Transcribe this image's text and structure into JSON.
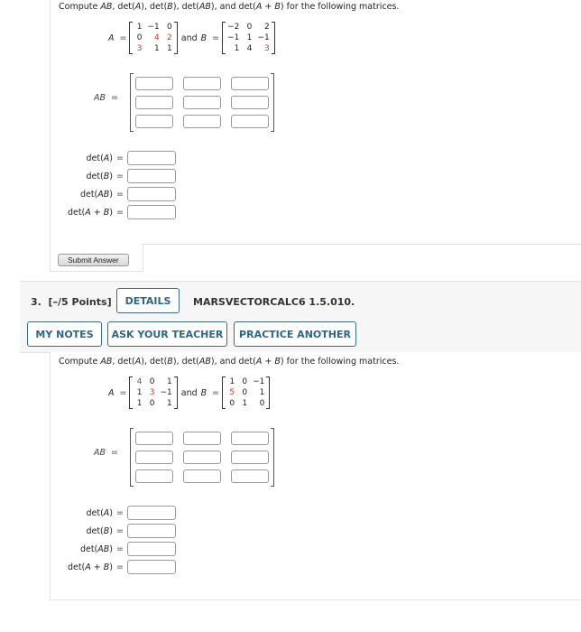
{
  "question2": {
    "prompt": {
      "pre": "Compute ",
      "parts": [
        "AB",
        ", det(",
        "A",
        "), det(",
        "B",
        "), det(",
        "AB",
        "), and det(",
        "A + B",
        ") for the following matrices."
      ]
    },
    "matrix_a_label": "A",
    "matrix_b_label": "B",
    "equals": "=",
    "and_text": "and",
    "matrix_a": [
      [
        "1",
        "−1",
        "0"
      ],
      [
        "0",
        "4",
        "2"
      ],
      [
        "3",
        "1",
        "1"
      ]
    ],
    "matrix_a_red": [
      [
        false,
        false,
        false
      ],
      [
        false,
        true,
        true
      ],
      [
        true,
        false,
        false
      ]
    ],
    "matrix_b": [
      [
        "−2",
        "0",
        "2"
      ],
      [
        "−1",
        "1",
        "−1"
      ],
      [
        "1",
        "4",
        "3"
      ]
    ],
    "matrix_b_red": [
      [
        false,
        false,
        false
      ],
      [
        false,
        false,
        false
      ],
      [
        false,
        false,
        true
      ]
    ],
    "ab_label": "AB",
    "det_rows": [
      {
        "pre": "det(",
        "var": "A",
        "post": ")"
      },
      {
        "pre": "det(",
        "var": "B",
        "post": ")"
      },
      {
        "pre": "det(",
        "var": "AB",
        "post": ")"
      },
      {
        "pre": "det(",
        "var": "A + B",
        "post": ")"
      }
    ],
    "submit_label": "Submit Answer"
  },
  "question3": {
    "number": "3.",
    "points": "[–/5 Points]",
    "details_label": "DETAILS",
    "code": "MARSVECTORCALC6 1.5.010.",
    "my_notes_label": "MY NOTES",
    "ask_teacher_label": "ASK YOUR TEACHER",
    "practice_another_label": "PRACTICE ANOTHER",
    "matrix_a_label": "A",
    "matrix_b_label": "B",
    "equals": "=",
    "and_text": "and",
    "matrix_a": [
      [
        "4",
        "0",
        "1"
      ],
      [
        "1",
        "3",
        "−1"
      ],
      [
        "1",
        "0",
        "1"
      ]
    ],
    "matrix_a_red": [
      [
        true,
        false,
        false
      ],
      [
        false,
        true,
        false
      ],
      [
        false,
        false,
        false
      ]
    ],
    "matrix_b": [
      [
        "1",
        "0",
        "−1"
      ],
      [
        "5",
        "0",
        "1"
      ],
      [
        "0",
        "1",
        "0"
      ]
    ],
    "matrix_b_red": [
      [
        false,
        false,
        false
      ],
      [
        true,
        false,
        false
      ],
      [
        false,
        false,
        false
      ]
    ],
    "ab_label": "AB",
    "det_rows": [
      {
        "pre": "det(",
        "var": "A",
        "post": ")"
      },
      {
        "pre": "det(",
        "var": "B",
        "post": ")"
      },
      {
        "pre": "det(",
        "var": "AB",
        "post": ")"
      },
      {
        "pre": "det(",
        "var": "A + B",
        "post": ")"
      }
    ]
  },
  "colors": {
    "accent": "#2e6688",
    "highlight_red": "#c0392b",
    "header_bg": "#f6f6f6"
  }
}
